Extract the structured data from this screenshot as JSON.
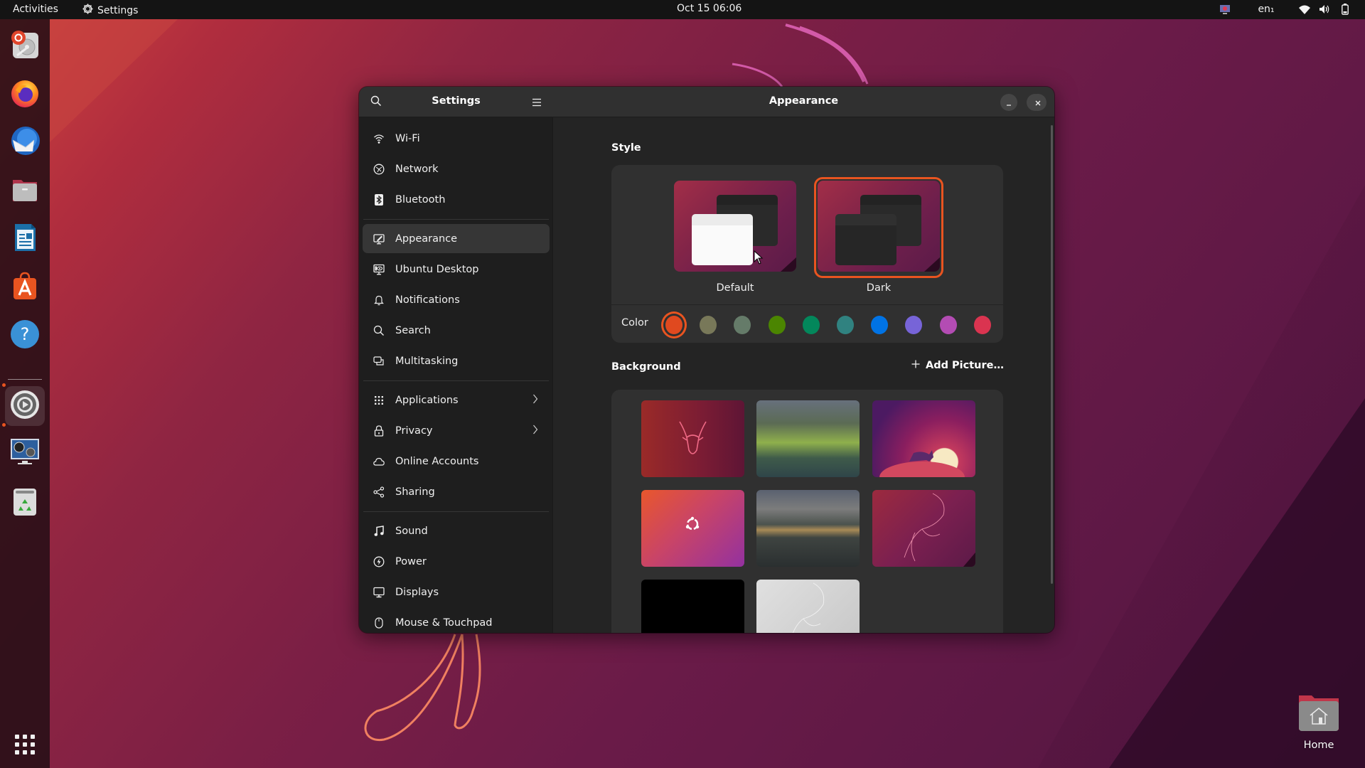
{
  "topbar": {
    "activities_label": "Activities",
    "app_menu_label": "Settings",
    "app_menu_icon": "gear-icon",
    "clock": "Oct 15  06:06",
    "keyboard_layout": "en₁",
    "tray_icons": [
      "screen-sharing-icon",
      "wifi-icon",
      "volume-icon",
      "battery-icon"
    ]
  },
  "dock": {
    "apps": [
      {
        "name": "Install Ubuntu",
        "icon": "installer-icon",
        "running": false
      },
      {
        "name": "Firefox",
        "icon": "firefox-icon",
        "running": false
      },
      {
        "name": "Thunderbird",
        "icon": "thunderbird-icon",
        "running": false
      },
      {
        "name": "Files",
        "icon": "files-icon",
        "running": false
      },
      {
        "name": "LibreOffice Writer",
        "icon": "writer-icon",
        "running": false
      },
      {
        "name": "Ubuntu Software",
        "icon": "software-icon",
        "running": false
      },
      {
        "name": "Help",
        "icon": "help-icon",
        "running": false
      },
      {
        "name": "Settings",
        "icon": "settings-icon",
        "running": true,
        "active": true
      },
      {
        "name": "Media Player",
        "icon": "media-player-icon",
        "running": true
      },
      {
        "name": "Trash",
        "icon": "trash-icon",
        "running": false
      }
    ],
    "show_apps_icon": "app-grid-icon"
  },
  "window": {
    "sidebar_title": "Settings",
    "content_title": "Appearance",
    "sidebar_groups": [
      [
        {
          "label": "Wi-Fi",
          "icon": "wifi-icon"
        },
        {
          "label": "Network",
          "icon": "network-icon"
        },
        {
          "label": "Bluetooth",
          "icon": "bluetooth-icon"
        }
      ],
      [
        {
          "label": "Appearance",
          "icon": "appearance-icon",
          "selected": true
        },
        {
          "label": "Ubuntu Desktop",
          "icon": "ubuntu-desktop-icon"
        },
        {
          "label": "Notifications",
          "icon": "bell-icon"
        },
        {
          "label": "Search",
          "icon": "search-icon"
        },
        {
          "label": "Multitasking",
          "icon": "multitasking-icon"
        }
      ],
      [
        {
          "label": "Applications",
          "icon": "apps-grid-icon",
          "has_submenu": true
        },
        {
          "label": "Privacy",
          "icon": "lock-icon",
          "has_submenu": true
        },
        {
          "label": "Online Accounts",
          "icon": "cloud-icon"
        },
        {
          "label": "Sharing",
          "icon": "share-icon"
        }
      ],
      [
        {
          "label": "Sound",
          "icon": "music-note-icon"
        },
        {
          "label": "Power",
          "icon": "power-icon"
        },
        {
          "label": "Displays",
          "icon": "display-icon"
        },
        {
          "label": "Mouse & Touchpad",
          "icon": "mouse-icon"
        }
      ]
    ],
    "appearance": {
      "style_label": "Style",
      "styles": [
        {
          "label": "Default",
          "selected": false
        },
        {
          "label": "Dark",
          "selected": true
        }
      ],
      "color_label": "Color",
      "accent_colors": [
        {
          "name": "orange",
          "hex": "#e0491f",
          "selected": true
        },
        {
          "name": "bark",
          "hex": "#787859"
        },
        {
          "name": "sage",
          "hex": "#657b69"
        },
        {
          "name": "olive",
          "hex": "#4b8501"
        },
        {
          "name": "viridian",
          "hex": "#03875b"
        },
        {
          "name": "prussian-green",
          "hex": "#308280"
        },
        {
          "name": "blue",
          "hex": "#0073e5"
        },
        {
          "name": "purple",
          "hex": "#7764d8"
        },
        {
          "name": "magenta",
          "hex": "#b34cb3"
        },
        {
          "name": "red",
          "hex": "#da3450"
        }
      ],
      "background_label": "Background",
      "add_picture_label": "Add Picture…",
      "backgrounds": [
        {
          "name": "kudu-red"
        },
        {
          "name": "mountain-lake"
        },
        {
          "name": "kudu-moon"
        },
        {
          "name": "ubuntu-logo-gradient"
        },
        {
          "name": "misty-valley"
        },
        {
          "name": "kudu-outline-purple"
        },
        {
          "name": "black"
        },
        {
          "name": "kudu-outline-grey"
        }
      ]
    }
  },
  "desktop": {
    "home_label": "Home"
  },
  "colors": {
    "accent": "#e95420",
    "topbar_bg": "#141414",
    "window_bg": "#242424",
    "header_bg": "#303030"
  }
}
